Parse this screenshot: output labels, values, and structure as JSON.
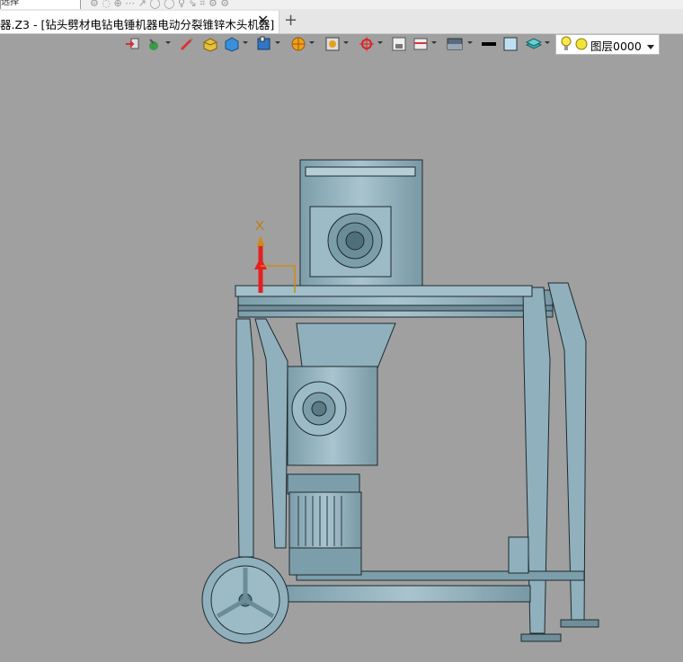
{
  "top_strip": {
    "select_value": "选择"
  },
  "tab": {
    "title": "器.Z3 - [钻头劈材电钻电锤机器电动分裂锥锌木头机器]",
    "close_label": "✕",
    "add_label": "+"
  },
  "toolbar": {
    "icons": [
      "import-icon",
      "color-icon",
      "pen-icon",
      "block-icon",
      "solid-view-icon",
      "display-mode-icon",
      "render-icon",
      "frame-icon",
      "origin-icon",
      "view-icon",
      "clip-icon",
      "background-icon",
      "line-color-icon",
      "fill-color-icon",
      "layer-stack-icon"
    ]
  },
  "layer": {
    "name": "图层0000"
  },
  "viewport": {
    "axis_label": "X"
  },
  "colors": {
    "model": "#8fb0bc",
    "background": "#a0a0a0",
    "axis_red": "#e51f1f",
    "axis_x": "#d08a10"
  }
}
